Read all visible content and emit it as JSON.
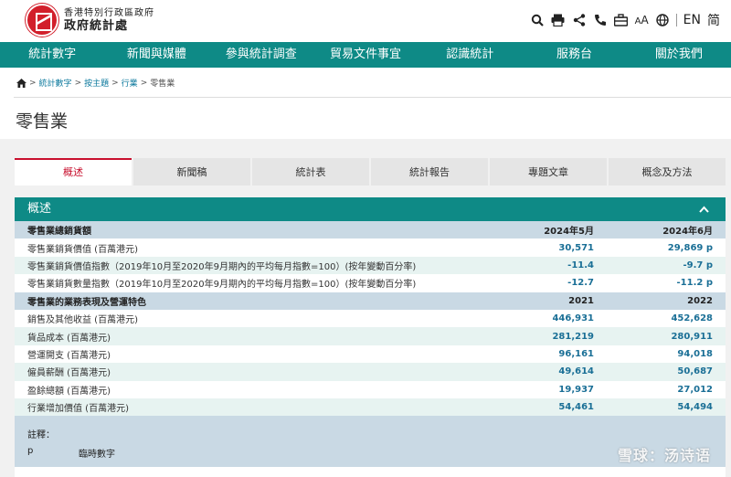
{
  "header": {
    "site_line1": "香港特別行政區政府",
    "site_line2": "政府統計處",
    "font_small": "A",
    "font_large": "A",
    "lang_en": "EN",
    "lang_sc": "简"
  },
  "nav": [
    "統計數字",
    "新聞與媒體",
    "參與統計調查",
    "貿易文件事宜",
    "認識統計",
    "服務台",
    "關於我們"
  ],
  "breadcrumb": {
    "items": [
      "統計數字",
      "按主題",
      "行業"
    ],
    "sep": ">",
    "current": "零售業"
  },
  "page_title": "零售業",
  "tabs": [
    {
      "label": "概述",
      "active": true
    },
    {
      "label": "新聞稿",
      "active": false
    },
    {
      "label": "統計表",
      "active": false
    },
    {
      "label": "統計報告",
      "active": false
    },
    {
      "label": "專題文章",
      "active": false
    },
    {
      "label": "概念及方法",
      "active": false
    }
  ],
  "panel": {
    "title": "概述",
    "collapse_glyph": "^"
  },
  "table": {
    "section1": {
      "title": "零售業總銷貨額",
      "col1": "2024年5月",
      "col2": "2024年6月",
      "rows": [
        {
          "label": "零售業銷貨價值 (百萬港元)",
          "v1": "30,571",
          "v2": "29,869 p"
        },
        {
          "label": "零售業銷貨價值指數（2019年10月至2020年9月期內的平均每月指數=100）(按年變動百分率)",
          "v1": "-11.4",
          "v2": "-9.7 p"
        },
        {
          "label": "零售業銷貨數量指數（2019年10月至2020年9月期內的平均每月指數=100）(按年變動百分率)",
          "v1": "-12.7",
          "v2": "-11.2 p"
        }
      ]
    },
    "section2": {
      "title": "零售業的業務表現及營運特色",
      "col1": "2021",
      "col2": "2022",
      "rows": [
        {
          "label": "銷售及其他收益 (百萬港元)",
          "v1": "446,931",
          "v2": "452,628"
        },
        {
          "label": "貨品成本 (百萬港元)",
          "v1": "281,219",
          "v2": "280,911"
        },
        {
          "label": "營運開支 (百萬港元)",
          "v1": "96,161",
          "v2": "94,018"
        },
        {
          "label": "僱員薪酬 (百萬港元)",
          "v1": "49,614",
          "v2": "50,687"
        },
        {
          "label": "盈餘總額 (百萬港元)",
          "v1": "19,937",
          "v2": "27,012"
        },
        {
          "label": "行業增加價值 (百萬港元)",
          "v1": "54,461",
          "v2": "54,494"
        }
      ]
    }
  },
  "notes": {
    "title": "註釋：",
    "key": "p",
    "value": "臨時數字"
  },
  "watermark": "雪球：汤诗语",
  "colors": {
    "teal": "#0e8a86",
    "accent_red": "#c8102e",
    "value_blue": "#1a6f96"
  }
}
